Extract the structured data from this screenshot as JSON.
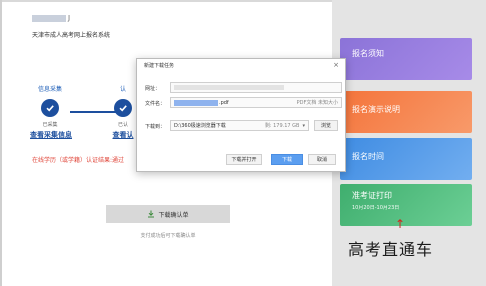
{
  "page": {
    "user_name_visible": "J",
    "system_name": "天津市成人高考网上报名系统",
    "steps": [
      {
        "title": "信息采集",
        "status": "已采集",
        "link": "查看采集信息"
      },
      {
        "title": "认",
        "status": "已认",
        "link": "查看认"
      }
    ],
    "warning": "在线学历（或学籍）认证结果:通过",
    "download_button": "下载确认单",
    "download_hint": "支付成功后可下载确认单"
  },
  "dialog": {
    "title": "新建下载任务",
    "close_label": "×",
    "url_label": "网址：",
    "filename_label": "文件名：",
    "filename_ext": ".pdf",
    "filename_meta": "PDF文档 未知大小",
    "download_to_label": "下载到：",
    "path": "D:\\360极速浏览器下载",
    "free_space": "剩: 179.17 GB",
    "browse_button": "浏览",
    "open_after_button": "下载并打开",
    "download_button": "下载",
    "cancel_button": "取消"
  },
  "sidebar": {
    "tiles": [
      {
        "label": "报名须知",
        "color": "#9a80e0"
      },
      {
        "label": "报名演示说明",
        "color": "#f4743b"
      },
      {
        "label": "报名时间",
        "color": "#4a93e6"
      },
      {
        "label": "准考证打印",
        "sub": "10月20日-10月23日",
        "color": "#4cb87b"
      }
    ],
    "watermark": "高考直通车",
    "arrow": "↑"
  }
}
